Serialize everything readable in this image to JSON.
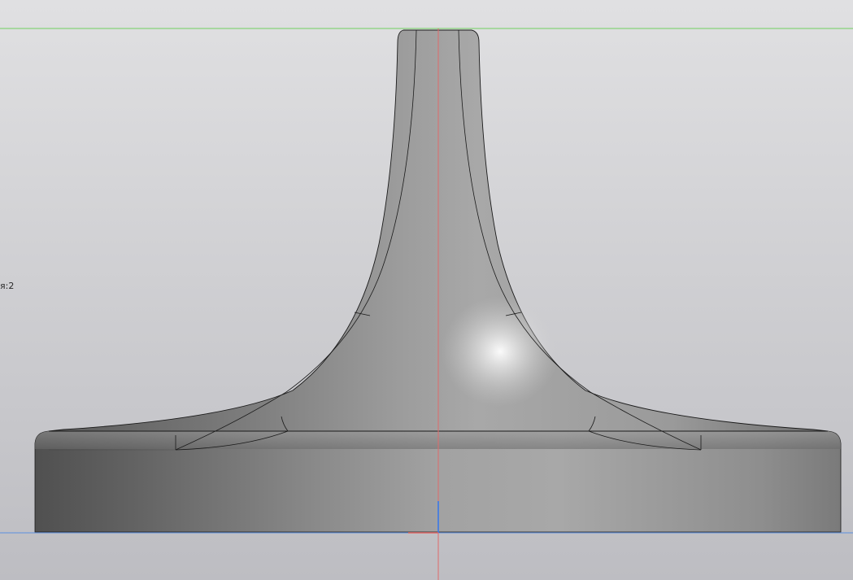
{
  "viewport": {
    "edge_label": "я:2",
    "background_top": "#e0e0e2",
    "background_bottom": "#bdbdc2"
  },
  "model": {
    "body_shade_dark": "#4e4e4e",
    "body_shade_light": "#aaaaaa",
    "edge_color": "#1a1a1a",
    "highlight": "#ffffff"
  },
  "axes": {
    "x_axis_color": "#5b8fe0",
    "y_axis_color": "#70d060",
    "z_axis_color": "#e06a6a"
  }
}
